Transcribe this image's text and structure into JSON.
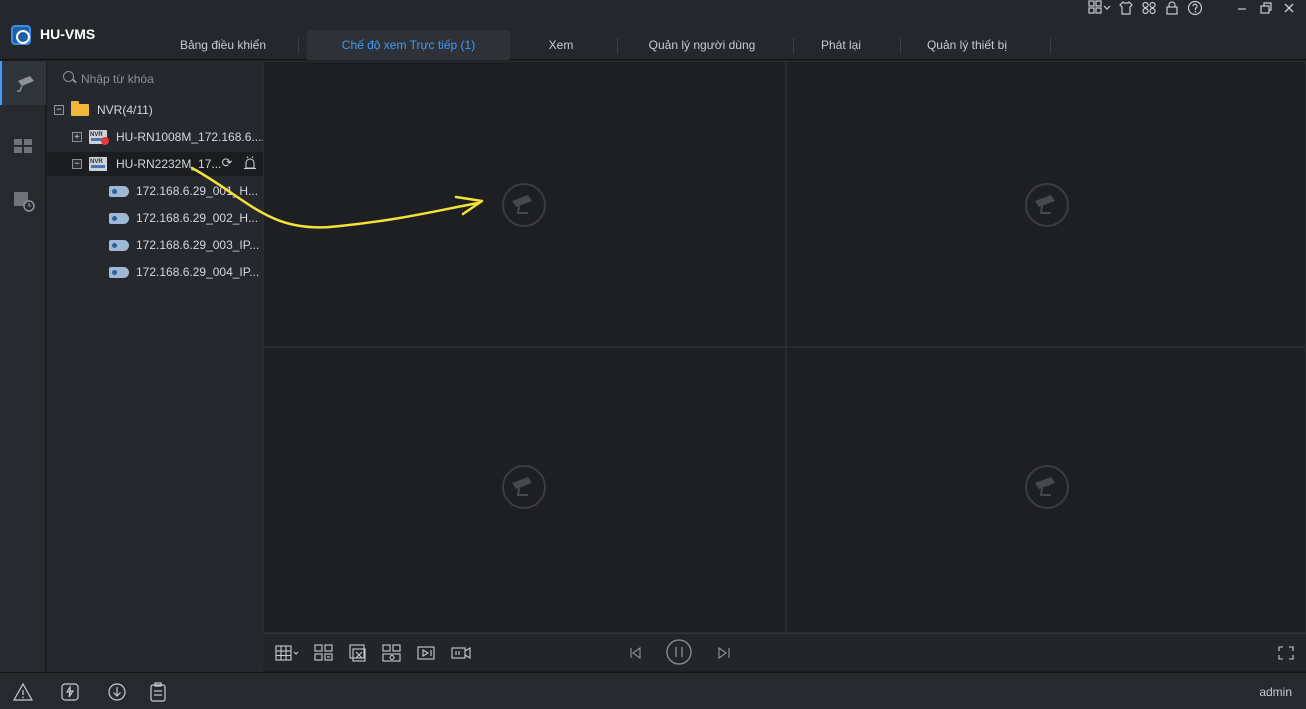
{
  "app": {
    "title": "HU-VMS"
  },
  "tabs": [
    {
      "label": "Bảng điều khiển",
      "active": false
    },
    {
      "label": "Chế độ xem Trực tiếp (1)",
      "active": true
    },
    {
      "label": "Xem",
      "active": false
    },
    {
      "label": "Quản lý người dùng",
      "active": false
    },
    {
      "label": "Phát lại",
      "active": false
    },
    {
      "label": "Quản lý thiết bị",
      "active": false
    }
  ],
  "window_tools": [
    "layout-menu-icon",
    "skin-icon",
    "link-icon",
    "lock-icon",
    "help-icon",
    "minimize-icon",
    "restore-icon",
    "close-icon"
  ],
  "rail": [
    {
      "name": "rail-live-view",
      "icon": "camera-icon",
      "active": true
    },
    {
      "name": "rail-view-layout",
      "icon": "grid-view-icon",
      "active": false
    },
    {
      "name": "rail-playback",
      "icon": "playback-search-icon",
      "active": false
    }
  ],
  "tree": {
    "search_placeholder": "Nhập từ khóa",
    "root": {
      "label": "NVR(4/11)",
      "expanded": true
    },
    "devices": [
      {
        "label": "HU-RN1008M_172.168.6....",
        "expanded": false,
        "status": "offline"
      },
      {
        "label": "HU-RN2232M_17...",
        "expanded": true,
        "status": "online",
        "selected": true,
        "channels": [
          "172.168.6.29_001_H...",
          "172.168.6.29_002_H...",
          "172.168.6.29_003_IP...",
          "172.168.6.29_004_IP..."
        ]
      }
    ]
  },
  "grid": {
    "layout": "2x2",
    "panes": 4
  },
  "toolbar": [
    "layout-select-icon",
    "save-view-icon",
    "close-all-icon",
    "snapshot-icon",
    "playback-icon",
    "record-icon",
    "prev-icon",
    "pause-icon",
    "next-icon",
    "fullscreen-icon"
  ],
  "statusbar": {
    "user": "admin",
    "buttons": [
      "alarm-icon",
      "upload-icon",
      "download-icon",
      "task-list-icon"
    ]
  },
  "colors": {
    "accent": "#3d9df5",
    "annotation_arrow": "#f2e23a"
  }
}
